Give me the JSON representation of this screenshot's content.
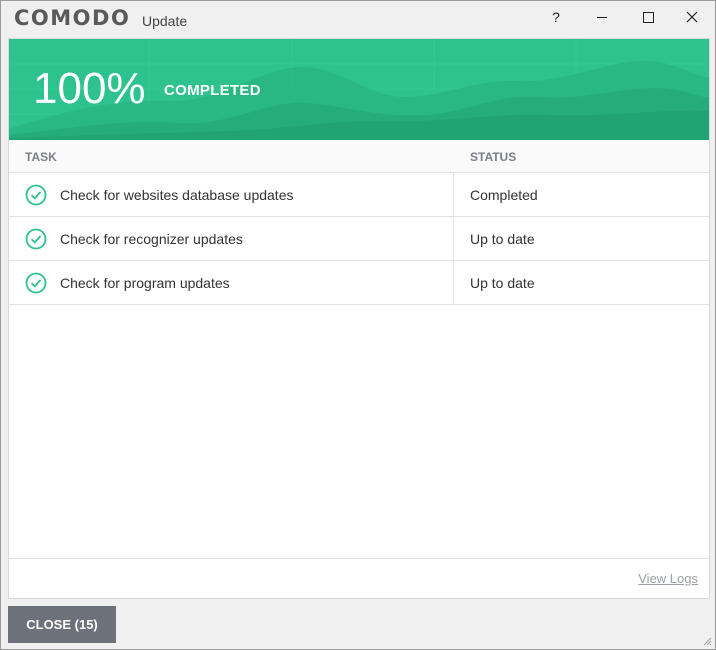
{
  "titlebar": {
    "logo": "COMODO",
    "title": "Update",
    "help": "?"
  },
  "banner": {
    "percent": "100%",
    "status": "COMPLETED",
    "progress_fraction": 1.0,
    "color": "#2ec28e"
  },
  "table": {
    "headers": {
      "task": "TASK",
      "status": "STATUS"
    },
    "rows": [
      {
        "task": "Check for websites database updates",
        "status": "Completed",
        "icon": "check-circle-icon"
      },
      {
        "task": "Check for recognizer updates",
        "status": "Up to date",
        "icon": "check-circle-icon"
      },
      {
        "task": "Check for program updates",
        "status": "Up to date",
        "icon": "check-circle-icon"
      }
    ]
  },
  "footer": {
    "view_logs": "View Logs",
    "close_label": "CLOSE (15)"
  }
}
